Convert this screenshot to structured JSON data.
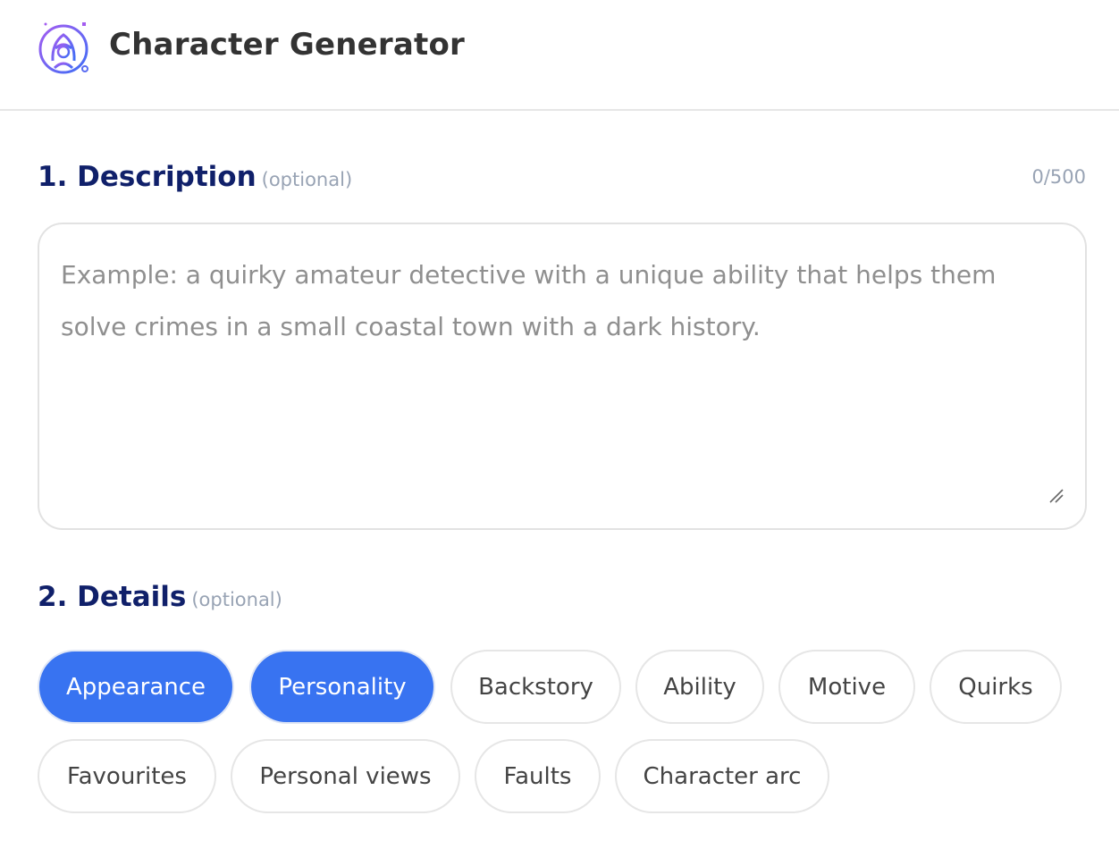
{
  "header": {
    "title": "Character Generator",
    "logo_icon": "character-portrait-icon"
  },
  "description": {
    "title": "1. Description",
    "optional_label": "(optional)",
    "counter": "0/500",
    "placeholder": "Example: a quirky amateur detective with a unique ability that helps them solve crimes in a small coastal town with a dark history.",
    "value": ""
  },
  "details": {
    "title": "2. Details",
    "optional_label": "(optional)",
    "accent_color": "#3873f1",
    "chips": [
      {
        "label": "Appearance",
        "selected": true
      },
      {
        "label": "Personality",
        "selected": true
      },
      {
        "label": "Backstory",
        "selected": false
      },
      {
        "label": "Ability",
        "selected": false
      },
      {
        "label": "Motive",
        "selected": false
      },
      {
        "label": "Quirks",
        "selected": false
      },
      {
        "label": "Favourites",
        "selected": false
      },
      {
        "label": "Personal views",
        "selected": false
      },
      {
        "label": "Faults",
        "selected": false
      },
      {
        "label": "Character arc",
        "selected": false
      }
    ]
  }
}
